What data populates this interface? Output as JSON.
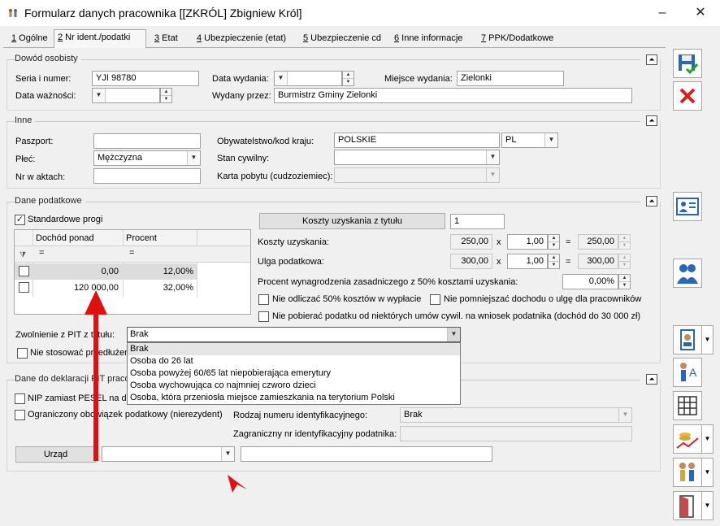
{
  "window": {
    "title": "Formularz danych pracownika [[ZKRÓL] Zbigniew Król]",
    "minimize": "–",
    "close": "✕"
  },
  "tabs": [
    {
      "num": "1",
      "label": " Ogólne"
    },
    {
      "num": "2",
      "label": " Nr ident./podatki"
    },
    {
      "num": "3",
      "label": " Etat"
    },
    {
      "num": "4",
      "label": " Ubezpieczenie (etat)"
    },
    {
      "num": "5",
      "label": " Ubezpieczenie cd"
    },
    {
      "num": "6",
      "label": " Inne informacje"
    },
    {
      "num": "7",
      "label": " PPK/Dodatkowe"
    }
  ],
  "dowod": {
    "title": "Dowód osobisty",
    "seria_label": "Seria i numer:",
    "seria_value": "YJI 98780",
    "data_wydania_label": "Data wydania:",
    "data_wydania_value": "",
    "miejsce_label": "Miejsce wydania:",
    "miejsce_value": "Zielonki",
    "waznosc_label": "Data ważności:",
    "waznosc_value": "",
    "wydany_label": "Wydany przez:",
    "wydany_value": "Burmistrz Gminy Zielonki"
  },
  "inne": {
    "title": "Inne",
    "paszport_label": "Paszport:",
    "paszport_value": "",
    "obywatelstwo_label": "Obywatelstwo/kod kraju:",
    "obywatelstwo_value": "POLSKIE",
    "kod_kraju": "PL",
    "plec_label": "Płeć:",
    "plec_value": "Mężczyzna",
    "stan_label": "Stan cywilny:",
    "stan_value": "",
    "akta_label": "Nr w aktach:",
    "akta_value": "",
    "karta_label": "Karta pobytu (cudzoziemiec):",
    "karta_value": ""
  },
  "podatkowe": {
    "title": "Dane podatkowe",
    "standardowe_label": "Standardowe progi",
    "grid_headers": [
      "Dochód ponad",
      "Procent"
    ],
    "filter_ops": [
      "=",
      "="
    ],
    "rows": [
      {
        "dochod": "0,00",
        "procent": "12,00%"
      },
      {
        "dochod": "120 000,00",
        "procent": "32,00%"
      }
    ],
    "koszty_tytul_btn": "Koszty uzyskania z tytułu",
    "koszty_tytul_value": "1",
    "koszty_label": "Koszty uzyskania:",
    "koszty_value": "250,00",
    "koszty_mult": "1,00",
    "koszty_result": "250,00",
    "ulga_label": "Ulga podatkowa:",
    "ulga_value": "300,00",
    "ulga_mult": "1,00",
    "ulga_result": "300,00",
    "x": "x",
    "eq": "=",
    "procent_label": "Procent wynagrodzenia zasadniczego z 50% kosztami uzyskania:",
    "procent_value": "0,00%",
    "nie_odliczac": "Nie odliczać 50% kosztów w wypłacie",
    "nie_pomniejszac": "Nie pomniejszać dochodu o ulgę dla pracowników",
    "nie_pobierac": "Nie pobierać podatku od niektórych umów cywil. na wniosek podatnika (dochód do 30 000 zł)",
    "zwolnienie_label": "Zwolnienie z PIT z tytułu:",
    "zwolnienie_value": "Brak",
    "nie_stosowac": "Nie stosować przedłużen"
  },
  "dropdown_options": [
    "Brak",
    "Osoba do 26 lat",
    "Osoba powyżej 60/65 lat niepobierająca emerytury",
    "Osoba wychowująca co najmniej czworo dzieci",
    "Osoba, która przeniosła miejsce zamieszkania na terytorium Polski"
  ],
  "deklaracje": {
    "title": "Dane do deklaracji PIT praco",
    "nip_label": "NIP zamiast PESEL na dek",
    "ograniczony_label": "Ograniczony obowiązek podatkowy (nierezydent)",
    "rodzaj_label": "Rodzaj numeru identyfikacyjnego:",
    "rodzaj_value": "Brak",
    "zagraniczny_label": "Zagraniczny nr identyfikacyjny podatnika:",
    "zagraniczny_value": "",
    "urzad_btn": "Urząd",
    "urzad_value": "",
    "urzad_name": ""
  },
  "colors": {
    "arrow": "#e01010",
    "accent_blue": "#2a66b8",
    "red_x": "#d42020"
  }
}
